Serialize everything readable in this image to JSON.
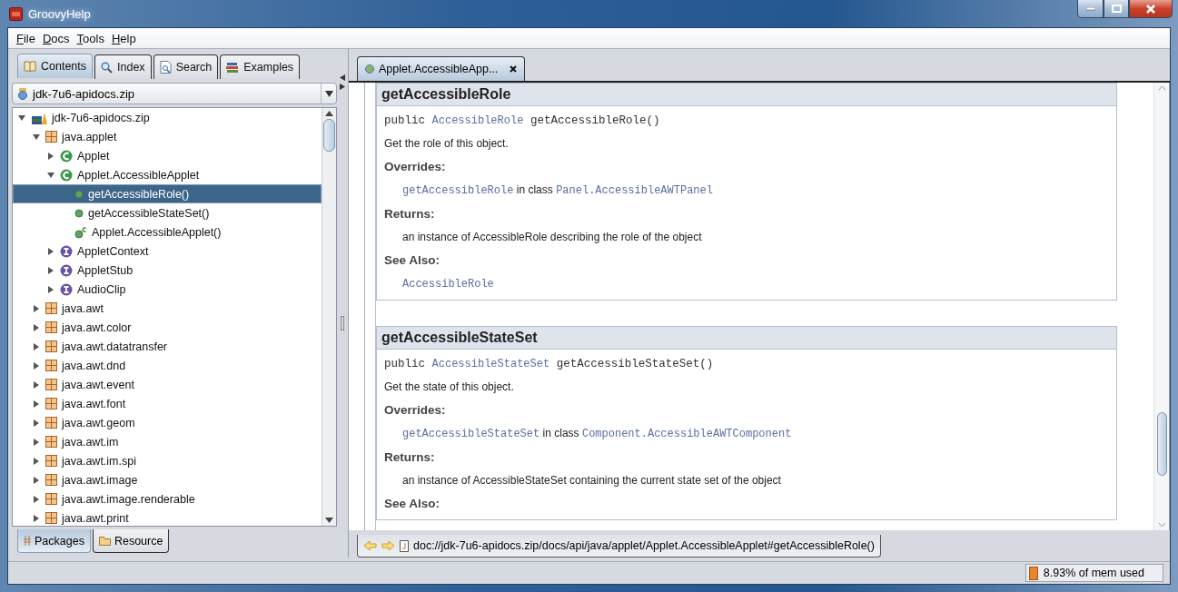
{
  "window": {
    "title": "GroovyHelp"
  },
  "menu": [
    "File",
    "Docs",
    "Tools",
    "Help"
  ],
  "nav_tabs": [
    {
      "label": "Contents",
      "selected": true
    },
    {
      "label": "Index",
      "selected": false
    },
    {
      "label": "Search",
      "selected": false
    },
    {
      "label": "Examples",
      "selected": false
    }
  ],
  "doc_set": {
    "value": "jdk-7u6-apidocs.zip"
  },
  "tree": [
    {
      "label": "jdk-7u6-apidocs.zip",
      "kind": "archive",
      "expanded": true,
      "selected": false,
      "children": [
        {
          "label": "java.applet",
          "kind": "package",
          "expanded": true,
          "selected": false,
          "children": [
            {
              "label": "Applet",
              "kind": "class",
              "expanded": false,
              "selected": false
            },
            {
              "label": "Applet.AccessibleApplet",
              "kind": "class",
              "expanded": true,
              "selected": false,
              "children": [
                {
                  "label": "getAccessibleRole()",
                  "kind": "method",
                  "selected": true
                },
                {
                  "label": "getAccessibleStateSet()",
                  "kind": "method",
                  "selected": false
                },
                {
                  "label": "Applet.AccessibleApplet()",
                  "kind": "constructor",
                  "selected": false
                }
              ]
            },
            {
              "label": "AppletContext",
              "kind": "interface",
              "expanded": false,
              "selected": false
            },
            {
              "label": "AppletStub",
              "kind": "interface",
              "expanded": false,
              "selected": false
            },
            {
              "label": "AudioClip",
              "kind": "interface",
              "expanded": false,
              "selected": false
            }
          ]
        },
        {
          "label": "java.awt",
          "kind": "package",
          "expanded": false,
          "selected": false
        },
        {
          "label": "java.awt.color",
          "kind": "package",
          "expanded": false,
          "selected": false
        },
        {
          "label": "java.awt.datatransfer",
          "kind": "package",
          "expanded": false,
          "selected": false
        },
        {
          "label": "java.awt.dnd",
          "kind": "package",
          "expanded": false,
          "selected": false
        },
        {
          "label": "java.awt.event",
          "kind": "package",
          "expanded": false,
          "selected": false
        },
        {
          "label": "java.awt.font",
          "kind": "package",
          "expanded": false,
          "selected": false
        },
        {
          "label": "java.awt.geom",
          "kind": "package",
          "expanded": false,
          "selected": false
        },
        {
          "label": "java.awt.im",
          "kind": "package",
          "expanded": false,
          "selected": false
        },
        {
          "label": "java.awt.im.spi",
          "kind": "package",
          "expanded": false,
          "selected": false
        },
        {
          "label": "java.awt.image",
          "kind": "package",
          "expanded": false,
          "selected": false
        },
        {
          "label": "java.awt.image.renderable",
          "kind": "package",
          "expanded": false,
          "selected": false
        },
        {
          "label": "java.awt.print",
          "kind": "package",
          "expanded": false,
          "selected": false
        }
      ]
    }
  ],
  "bottom_tabs": [
    {
      "label": "Packages",
      "selected": true
    },
    {
      "label": "Resource",
      "selected": false
    }
  ],
  "doc_tabs": [
    {
      "label": "Applet.AccessibleApp...",
      "selected": true
    }
  ],
  "sections": [
    {
      "heading": "getAccessibleRole",
      "signature": {
        "modifier": "public",
        "type": "AccessibleRole",
        "name": "getAccessibleRole()"
      },
      "description": "Get the role of this object.",
      "overrides_label": "Overrides:",
      "overrides": {
        "method": "getAccessibleRole",
        "connector": "in class",
        "class": "Panel.AccessibleAWTPanel"
      },
      "returns_label": "Returns:",
      "returns": "an instance of AccessibleRole describing the role of the object",
      "see_also_label": "See Also:",
      "see_also": "AccessibleRole"
    },
    {
      "heading": "getAccessibleStateSet",
      "signature": {
        "modifier": "public",
        "type": "AccessibleStateSet",
        "name": "getAccessibleStateSet()"
      },
      "description": "Get the state of this object.",
      "overrides_label": "Overrides:",
      "overrides": {
        "method": "getAccessibleStateSet",
        "connector": "in class",
        "class": "Component.AccessibleAWTComponent"
      },
      "returns_label": "Returns:",
      "returns": "an instance of AccessibleStateSet containing the current state set of the object",
      "see_also_label": "See Also:"
    }
  ],
  "address": "doc://jdk-7u6-apidocs.zip/docs/api/java/applet/Applet.AccessibleApplet#getAccessibleRole()",
  "status_bar": {
    "memory": "8.93% of mem used"
  }
}
